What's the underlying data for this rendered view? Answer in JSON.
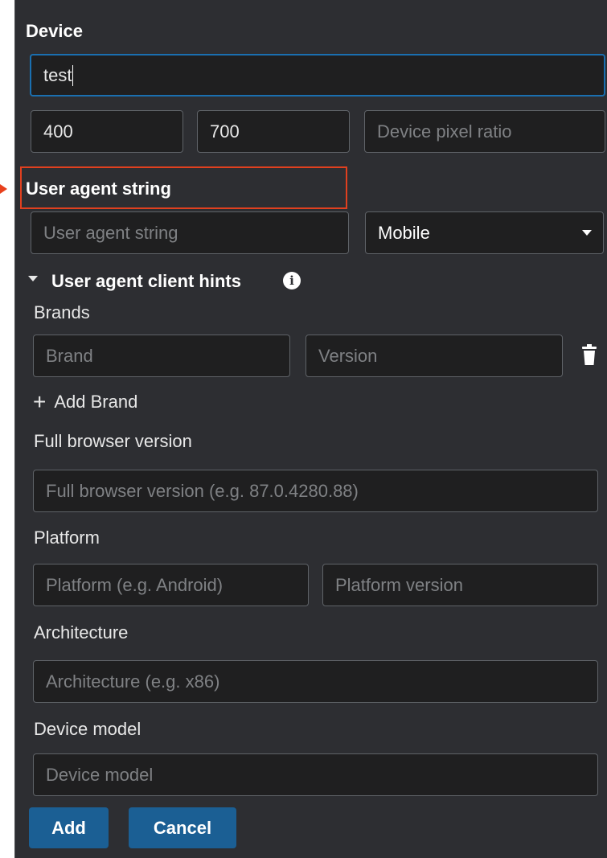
{
  "device": {
    "heading": "Device",
    "name_value": "test",
    "width_value": "400",
    "height_value": "700",
    "pixel_ratio_placeholder": "Device pixel ratio"
  },
  "user_agent": {
    "heading": "User agent string",
    "input_placeholder": "User agent string",
    "type_selected": "Mobile"
  },
  "client_hints": {
    "title": "User agent client hints",
    "info_icon": "info-icon",
    "brands_label": "Brands",
    "brand_placeholder": "Brand",
    "version_placeholder": "Version",
    "delete_icon": "trash-icon",
    "add_brand_label": "Add Brand",
    "full_browser_version_label": "Full browser version",
    "full_browser_version_placeholder": "Full browser version (e.g. 87.0.4280.88)",
    "platform_label": "Platform",
    "platform_placeholder": "Platform (e.g. Android)",
    "platform_version_placeholder": "Platform version",
    "architecture_label": "Architecture",
    "architecture_placeholder": "Architecture (e.g. x86)",
    "device_model_label": "Device model",
    "device_model_placeholder": "Device model"
  },
  "actions": {
    "add_label": "Add",
    "cancel_label": "Cancel"
  },
  "colors": {
    "panel_bg": "#2d2e32",
    "input_bg": "#1f1f20",
    "button_bg": "#1b5f94",
    "focus_border": "#1a6fb0",
    "highlight_border": "#e0401f"
  }
}
